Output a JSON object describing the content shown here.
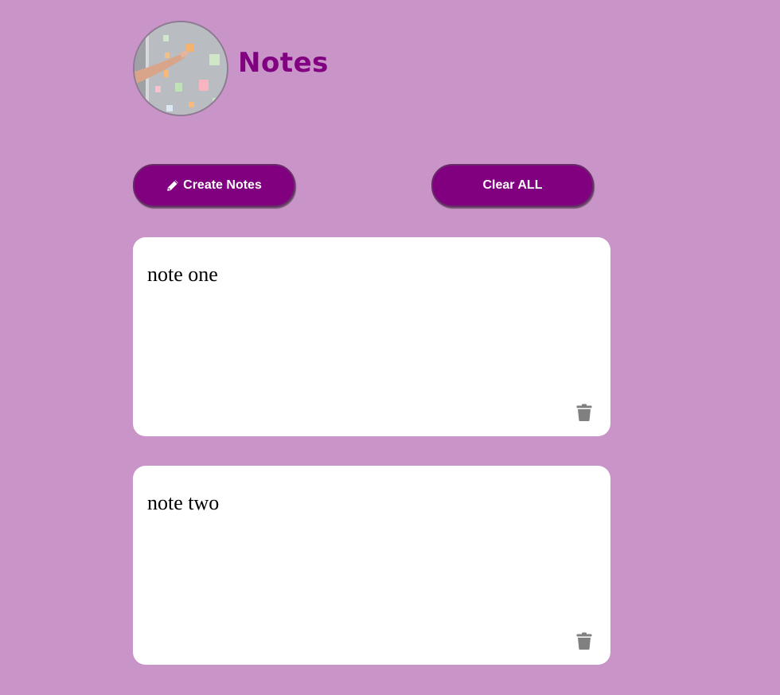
{
  "header": {
    "title": "Notes"
  },
  "toolbar": {
    "create_label": "Create Notes",
    "clear_label": "Clear ALL"
  },
  "notes": [
    {
      "text": "note one"
    },
    {
      "text": "note two"
    }
  ],
  "colors": {
    "background": "#c994c7",
    "accent": "#800080",
    "card": "#ffffff",
    "trash_icon": "#808080"
  },
  "icons": {
    "create": "pencil-icon",
    "delete": "trash-icon"
  }
}
